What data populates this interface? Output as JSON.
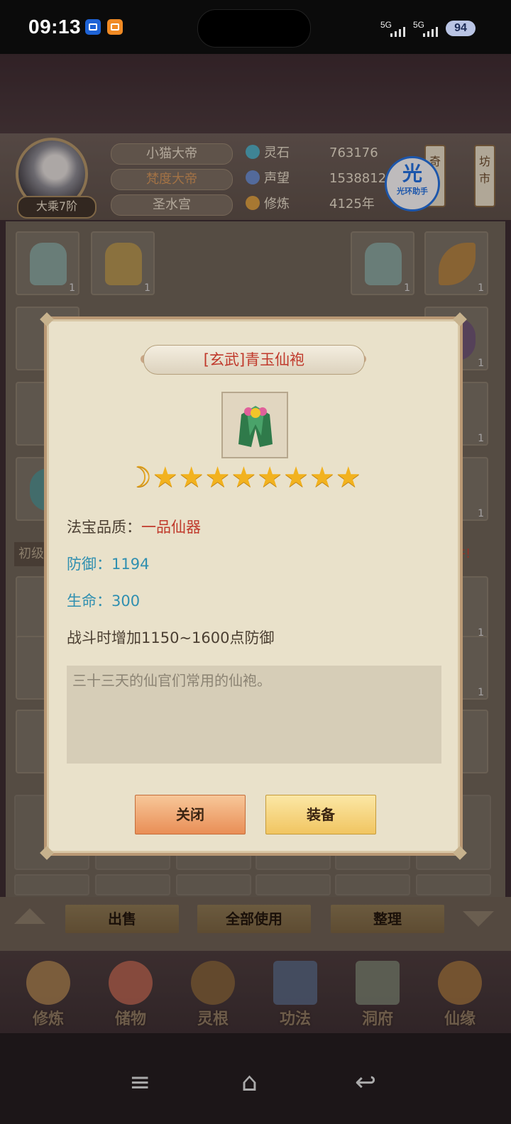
{
  "status_bar": {
    "time": "09:13",
    "signal1": "5G",
    "signal2": "5G",
    "battery": "94"
  },
  "player": {
    "rank": "大乘7阶",
    "name": "小猫大帝",
    "title": "梵度大帝",
    "sect": "圣水宫"
  },
  "stats": [
    {
      "label": "灵石",
      "value": "763176",
      "icon_color": "#4fb3c9"
    },
    {
      "label": "声望",
      "value": "1538812",
      "icon_color": "#6b8fd1"
    },
    {
      "label": "修炼",
      "value": "4125年",
      "icon_color": "#e0a341"
    }
  ],
  "helper": {
    "glyph": "光",
    "label": "光环助手"
  },
  "side_tabs": {
    "tab1": "奇",
    "tab2_top": "坊",
    "tab2_bottom": "市"
  },
  "bag": {
    "slot_count": "1",
    "banner_left": "初级",
    "banner_right": "多件!"
  },
  "actions": {
    "sell": "出售",
    "use_all": "全部使用",
    "sort": "整理"
  },
  "bottom_nav": [
    {
      "label": "修炼",
      "icon_color": "#b38a52"
    },
    {
      "label": "储物",
      "icon_color": "#c56b54"
    },
    {
      "label": "灵根",
      "icon_color": "#8d6a3a"
    },
    {
      "label": "功法",
      "icon_color": "#5b6f8c"
    },
    {
      "label": "洞府",
      "icon_color": "#7f8a77"
    },
    {
      "label": "仙缘",
      "icon_color": "#a8793f"
    }
  ],
  "dialog": {
    "title": "[玄武]青玉仙袍",
    "stars": "★★★★★★★★",
    "moon": "☽",
    "quality_label": "法宝品质：",
    "quality_value": "一品仙器",
    "defense": "防御：1194",
    "life": "生命：300",
    "effect": "战斗时增加1150~1600点防御",
    "description": "三十三天的仙官们常用的仙袍。",
    "close_button": "关闭",
    "equip_button": "装备"
  },
  "system_nav": {
    "menu": "≡",
    "home": "⌂",
    "back": "↩"
  },
  "colors": {
    "accent_red": "#c0392b",
    "stat_blue": "#2f8fb0",
    "dialog_bg": "#e9e1ca"
  }
}
